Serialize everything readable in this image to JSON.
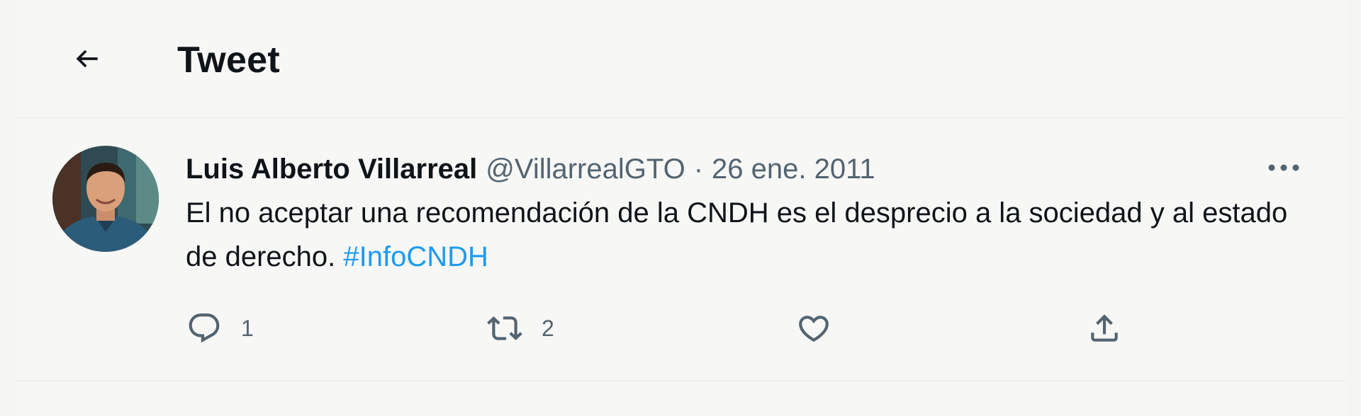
{
  "header": {
    "back_icon": "arrow-left-icon",
    "title": "Tweet"
  },
  "tweet": {
    "author_name": "Luis Alberto Villarreal",
    "author_handle": "@VillarrealGTO",
    "separator": "·",
    "date": "26 ene. 2011",
    "more_icon": "more-horizontal-icon",
    "text": "El no aceptar una recomendación de la CNDH es el desprecio a la sociedad y al estado de derecho.",
    "hashtag": "#InfoCNDH",
    "actions": {
      "reply": {
        "icon": "reply-icon",
        "count": "1"
      },
      "retweet": {
        "icon": "retweet-icon",
        "count": "2"
      },
      "like": {
        "icon": "like-icon"
      },
      "share": {
        "icon": "share-icon"
      }
    }
  },
  "colors": {
    "text": "#0f1419",
    "secondary": "#536471",
    "link": "#1d9bf0",
    "background": "#f7f7f6",
    "divider": "#e6e6e4"
  }
}
